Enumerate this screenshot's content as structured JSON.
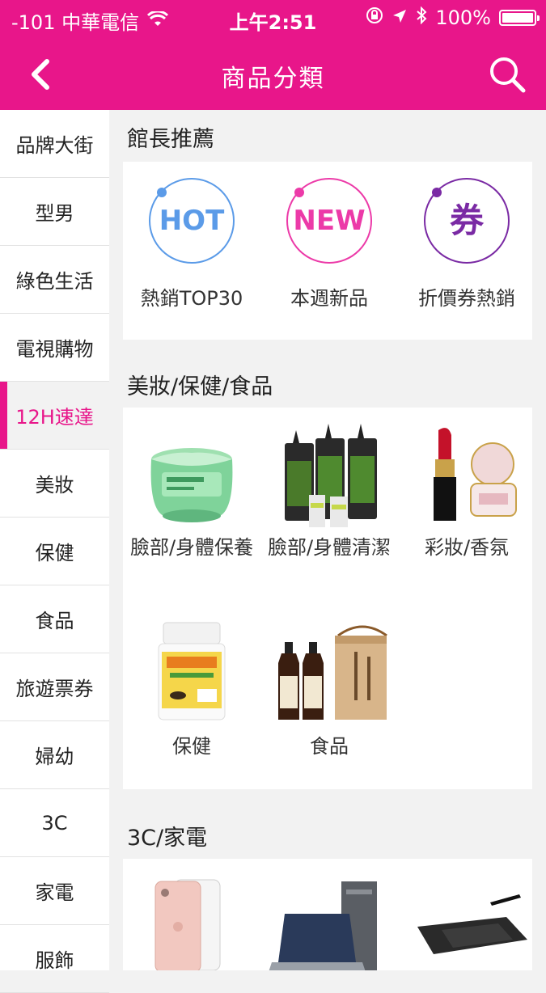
{
  "status": {
    "carrier": "-101 中華電信",
    "time": "上午2:51",
    "battery": "100%"
  },
  "nav": {
    "title": "商品分類"
  },
  "sidebar": {
    "items": [
      {
        "label": "品牌大街"
      },
      {
        "label": "型男"
      },
      {
        "label": "綠色生活"
      },
      {
        "label": "電視購物"
      },
      {
        "label": "12H速達",
        "active": true
      },
      {
        "label": "美妝"
      },
      {
        "label": "保健"
      },
      {
        "label": "食品"
      },
      {
        "label": "旅遊票券"
      },
      {
        "label": "婦幼"
      },
      {
        "label": "3C"
      },
      {
        "label": "家電"
      },
      {
        "label": "服飾"
      }
    ]
  },
  "sections": [
    {
      "title": "館長推薦",
      "tiles": [
        {
          "badge": "HOT",
          "label": "熱銷TOP30",
          "color": "#5b9be8"
        },
        {
          "badge": "NEW",
          "label": "本週新品",
          "color": "#ec3aa8"
        },
        {
          "badge": "券",
          "label": "折價券熱銷",
          "color": "#7a2aa4"
        }
      ]
    },
    {
      "title": "美妝/保健/食品",
      "tiles": [
        {
          "label": "臉部/身體保養",
          "icon": "cream-jar-image"
        },
        {
          "label": "臉部/身體清潔",
          "icon": "cleanser-bottles-image"
        },
        {
          "label": "彩妝/香氛",
          "icon": "lipstick-perfume-image"
        },
        {
          "label": "保健",
          "icon": "supplement-bottle-image"
        },
        {
          "label": "食品",
          "icon": "soy-sauce-gift-image"
        }
      ]
    },
    {
      "title": "3C/家電",
      "tiles": [
        {
          "label": "",
          "icon": "smartphone-image"
        },
        {
          "label": "",
          "icon": "desktop-laptop-image"
        },
        {
          "label": "",
          "icon": "drawing-tablet-image"
        }
      ]
    }
  ]
}
